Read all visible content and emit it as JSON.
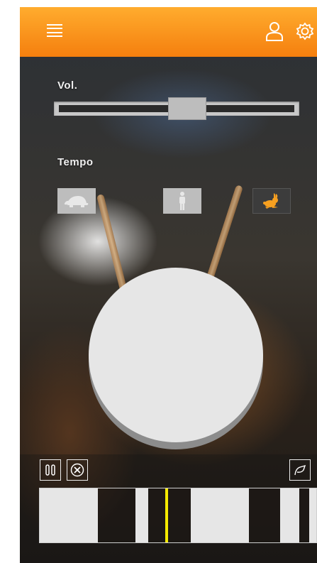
{
  "header": {
    "menu_icon": "hamburger-menu-icon",
    "user_icon": "user-icon",
    "settings_icon": "gear-icon",
    "color_top": "#ffac2e",
    "color_bottom": "#f57f0e"
  },
  "volume": {
    "label": "Vol.",
    "level": 0.55
  },
  "tempo": {
    "label": "Tempo",
    "options": [
      {
        "name": "slow",
        "icon": "turtle-icon",
        "selected": false
      },
      {
        "name": "normal",
        "icon": "person-icon",
        "selected": false
      },
      {
        "name": "fast",
        "icon": "rabbit-icon",
        "selected": true
      }
    ],
    "accent_color": "#f7a020"
  },
  "pad": {
    "icon": "drum-pad"
  },
  "controls": {
    "pause_icon": "pause-icon",
    "clear_icon": "clear-circle-x-icon",
    "share_icon": "share-curve-icon"
  },
  "timeline": {
    "segments": [
      {
        "start": 0.0,
        "end": 0.21
      },
      {
        "start": 0.345,
        "end": 0.39
      },
      {
        "start": 0.545,
        "end": 0.755
      },
      {
        "start": 0.87,
        "end": 0.94
      },
      {
        "start": 0.975,
        "end": 1.0
      }
    ],
    "playhead": 0.455,
    "playhead_color": "#f5ea00"
  }
}
